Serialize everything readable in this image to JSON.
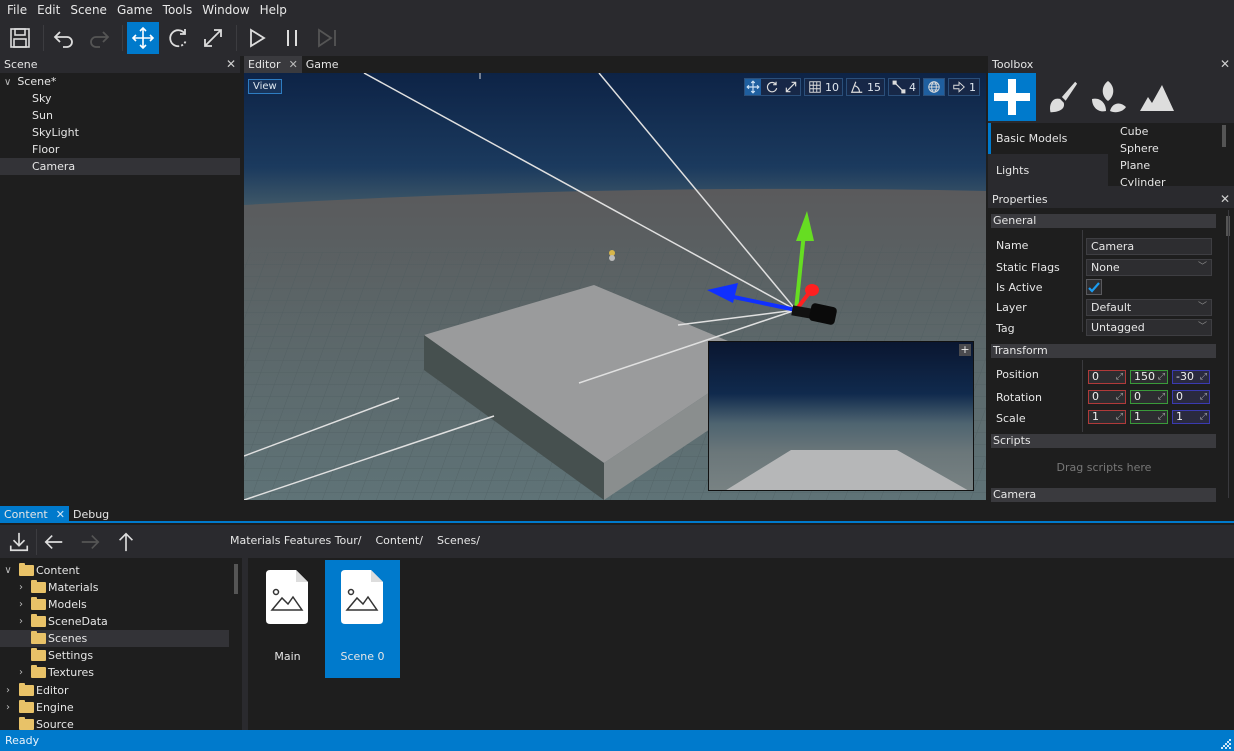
{
  "menu": [
    "File",
    "Edit",
    "Scene",
    "Game",
    "Tools",
    "Window",
    "Help"
  ],
  "toolbar": {
    "buttons": [
      {
        "name": "save-icon",
        "label": "Save"
      },
      {
        "name": "undo-icon",
        "label": "Undo"
      },
      {
        "name": "redo-icon",
        "label": "Redo",
        "disabled": true
      },
      {
        "name": "translate-icon",
        "label": "Translate",
        "active": true
      },
      {
        "name": "rotate-icon",
        "label": "Rotate"
      },
      {
        "name": "scale-icon",
        "label": "Scale"
      },
      {
        "name": "play-icon",
        "label": "Play"
      },
      {
        "name": "pause-icon",
        "label": "Pause"
      },
      {
        "name": "step-icon",
        "label": "Step",
        "disabled": true
      }
    ]
  },
  "scene_panel": {
    "title": "Scene",
    "close": "✕",
    "root": "Scene*",
    "items": [
      "Sky",
      "Sun",
      "SkyLight",
      "Floor",
      "Camera"
    ],
    "selected": "Camera"
  },
  "editor_tabs": [
    {
      "label": "Editor",
      "close": "✕",
      "active": true
    },
    {
      "label": "Game"
    }
  ],
  "viewport": {
    "view_button": "View",
    "grid_size": "10",
    "angle_snap": "15",
    "scale_snap": "4",
    "camera_speed": "1",
    "preview_expand": "+"
  },
  "toolbox": {
    "title": "Toolbox",
    "close": "✕",
    "tabs": [
      "add-icon",
      "paint-icon",
      "foliage-icon",
      "terrain-icon"
    ],
    "categories": [
      "Basic Models",
      "Lights"
    ],
    "selected_category": "Basic Models",
    "items": [
      "Cube",
      "Sphere",
      "Plane",
      "Cylinder"
    ]
  },
  "properties": {
    "title": "Properties",
    "close": "✕",
    "sections": {
      "general": "General",
      "transform": "Transform",
      "scripts": "Scripts",
      "camera": "Camera"
    },
    "general": {
      "name_label": "Name",
      "name_value": "Camera",
      "static_flags_label": "Static Flags",
      "static_flags_value": "None",
      "is_active_label": "Is Active",
      "is_active": true,
      "layer_label": "Layer",
      "layer_value": "Default",
      "tag_label": "Tag",
      "tag_value": "Untagged"
    },
    "transform": {
      "position_label": "Position",
      "position": [
        "0",
        "150",
        "-30"
      ],
      "rotation_label": "Rotation",
      "rotation": [
        "0",
        "0",
        "0"
      ],
      "scale_label": "Scale",
      "scale": [
        "1",
        "1",
        "1"
      ]
    },
    "scripts_hint": "Drag scripts here"
  },
  "bottom_tabs": [
    {
      "label": "Content",
      "close": "✕",
      "active": true
    },
    {
      "label": "Debug"
    }
  ],
  "content": {
    "breadcrumbs": [
      "Materials Features Tour/",
      "Content/",
      "Scenes/"
    ],
    "tree": [
      {
        "label": "Content",
        "depth": 0,
        "expanded": true,
        "open": true
      },
      {
        "label": "Materials",
        "depth": 1,
        "collapsed": true
      },
      {
        "label": "Models",
        "depth": 1,
        "collapsed": true
      },
      {
        "label": "SceneData",
        "depth": 1,
        "collapsed": true
      },
      {
        "label": "Scenes",
        "depth": 1,
        "selected": true,
        "open": true
      },
      {
        "label": "Settings",
        "depth": 1
      },
      {
        "label": "Textures",
        "depth": 1,
        "collapsed": true
      },
      {
        "label": "Editor",
        "depth": 0,
        "collapsed": true
      },
      {
        "label": "Engine",
        "depth": 0,
        "collapsed": true
      },
      {
        "label": "Source",
        "depth": 0
      }
    ],
    "assets": [
      {
        "name": "Main"
      },
      {
        "name": "Scene 0",
        "selected": true
      }
    ]
  },
  "status": {
    "text": "Ready"
  },
  "colors": {
    "accent": "#007acc",
    "panel": "#2a2a2e",
    "background": "#1e1e1e"
  }
}
